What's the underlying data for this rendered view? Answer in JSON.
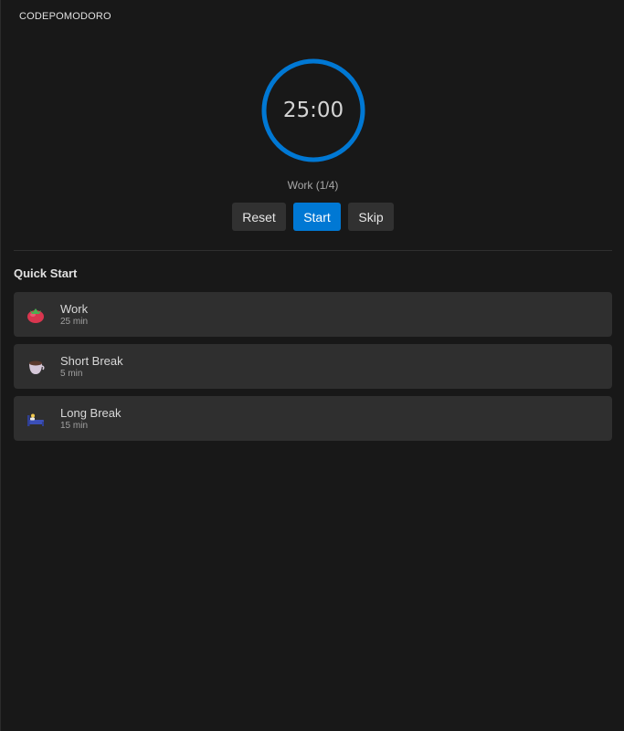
{
  "panel": {
    "title": "CODEPOMODORO"
  },
  "timer": {
    "display": "25:00",
    "progress_fraction": 1.0,
    "ring_color": "#0078d4",
    "session_label": "Work (1/4)"
  },
  "controls": {
    "reset_label": "Reset",
    "start_label": "Start",
    "skip_label": "Skip"
  },
  "quick_start": {
    "title": "Quick Start",
    "items": [
      {
        "icon": "tomato-icon",
        "name": "Work",
        "duration": "25 min"
      },
      {
        "icon": "coffee-cup-icon",
        "name": "Short Break",
        "duration": "5 min"
      },
      {
        "icon": "bed-icon",
        "name": "Long Break",
        "duration": "15 min"
      }
    ]
  },
  "colors": {
    "background": "#181818",
    "accent": "#0078d4",
    "card": "#2f2f2f",
    "button": "#313131"
  }
}
